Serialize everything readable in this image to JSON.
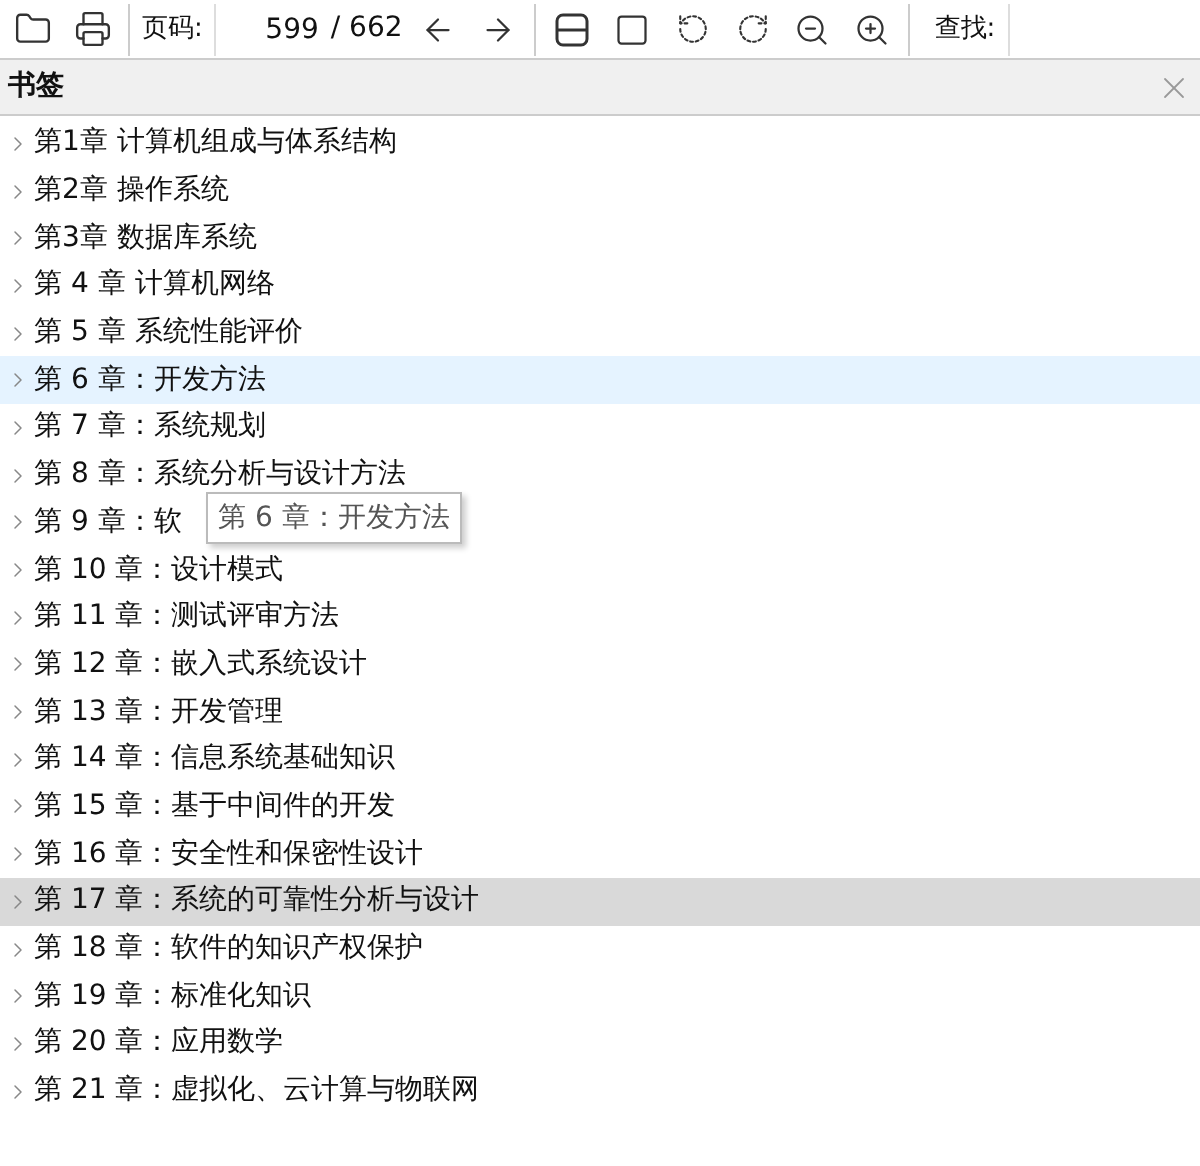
{
  "toolbar": {
    "page_label": "页码:",
    "page_value": "599",
    "page_total": "/ 662",
    "search_label": "查找:"
  },
  "bookmarks": {
    "title": "书签",
    "items": [
      {
        "label": "第1章 计算机组成与体系结构",
        "selected": false,
        "hovered": false
      },
      {
        "label": "第2章 操作系统",
        "selected": false,
        "hovered": false
      },
      {
        "label": "第3章 数据库系统",
        "selected": false,
        "hovered": false
      },
      {
        "label": "第 4 章 计算机网络",
        "selected": false,
        "hovered": false
      },
      {
        "label": "第 5 章 系统性能评价",
        "selected": false,
        "hovered": false
      },
      {
        "label": "第 6 章：开发方法",
        "selected": false,
        "hovered": true
      },
      {
        "label": "第 7 章：系统规划",
        "selected": false,
        "hovered": false
      },
      {
        "label": "第 8 章：系统分析与设计方法",
        "selected": false,
        "hovered": false
      },
      {
        "label": "第 9 章：软",
        "selected": false,
        "hovered": false
      },
      {
        "label": "第 10 章：设计模式",
        "selected": false,
        "hovered": false
      },
      {
        "label": "第 11 章：测试评审方法",
        "selected": false,
        "hovered": false
      },
      {
        "label": "第 12 章：嵌入式系统设计",
        "selected": false,
        "hovered": false
      },
      {
        "label": "第 13 章：开发管理",
        "selected": false,
        "hovered": false
      },
      {
        "label": "第 14 章：信息系统基础知识",
        "selected": false,
        "hovered": false
      },
      {
        "label": "第 15 章：基于中间件的开发",
        "selected": false,
        "hovered": false
      },
      {
        "label": "第 16 章：安全性和保密性设计",
        "selected": false,
        "hovered": false
      },
      {
        "label": "第 17 章：系统的可靠性分析与设计",
        "selected": true,
        "hovered": false
      },
      {
        "label": "第 18 章：软件的知识产权保护",
        "selected": false,
        "hovered": false
      },
      {
        "label": "第 19 章：标准化知识",
        "selected": false,
        "hovered": false
      },
      {
        "label": "第 20 章：应用数学",
        "selected": false,
        "hovered": false
      },
      {
        "label": "第 21 章：虚拟化、云计算与物联网",
        "selected": false,
        "hovered": false
      }
    ],
    "tooltip": {
      "text": "第 6 章：开发方法"
    }
  }
}
